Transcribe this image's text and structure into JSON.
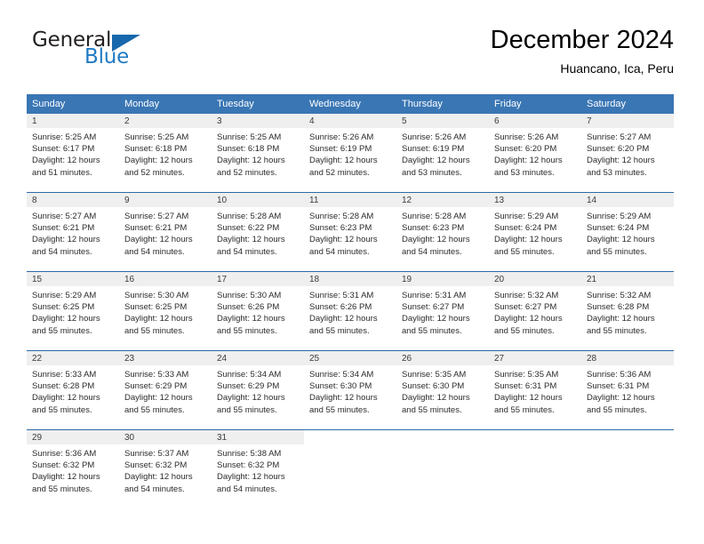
{
  "brand": {
    "name_part1": "General",
    "name_part2": "Blue",
    "logo_icon": "triangle-logo-icon"
  },
  "header": {
    "title": "December 2024",
    "location": "Huancano, Ica, Peru"
  },
  "colors": {
    "header_blue": "#3a76b4",
    "separator_blue": "#2e6aa8",
    "date_band_gray": "#efefef",
    "brand_blue": "#1f7ac4",
    "text": "#000000"
  },
  "weekdays": [
    "Sunday",
    "Monday",
    "Tuesday",
    "Wednesday",
    "Thursday",
    "Friday",
    "Saturday"
  ],
  "weeks": [
    [
      {
        "day": "1",
        "lines": [
          "Sunrise: 5:25 AM",
          "Sunset: 6:17 PM",
          "Daylight: 12 hours",
          "and 51 minutes."
        ]
      },
      {
        "day": "2",
        "lines": [
          "Sunrise: 5:25 AM",
          "Sunset: 6:18 PM",
          "Daylight: 12 hours",
          "and 52 minutes."
        ]
      },
      {
        "day": "3",
        "lines": [
          "Sunrise: 5:25 AM",
          "Sunset: 6:18 PM",
          "Daylight: 12 hours",
          "and 52 minutes."
        ]
      },
      {
        "day": "4",
        "lines": [
          "Sunrise: 5:26 AM",
          "Sunset: 6:19 PM",
          "Daylight: 12 hours",
          "and 52 minutes."
        ]
      },
      {
        "day": "5",
        "lines": [
          "Sunrise: 5:26 AM",
          "Sunset: 6:19 PM",
          "Daylight: 12 hours",
          "and 53 minutes."
        ]
      },
      {
        "day": "6",
        "lines": [
          "Sunrise: 5:26 AM",
          "Sunset: 6:20 PM",
          "Daylight: 12 hours",
          "and 53 minutes."
        ]
      },
      {
        "day": "7",
        "lines": [
          "Sunrise: 5:27 AM",
          "Sunset: 6:20 PM",
          "Daylight: 12 hours",
          "and 53 minutes."
        ]
      }
    ],
    [
      {
        "day": "8",
        "lines": [
          "Sunrise: 5:27 AM",
          "Sunset: 6:21 PM",
          "Daylight: 12 hours",
          "and 54 minutes."
        ]
      },
      {
        "day": "9",
        "lines": [
          "Sunrise: 5:27 AM",
          "Sunset: 6:21 PM",
          "Daylight: 12 hours",
          "and 54 minutes."
        ]
      },
      {
        "day": "10",
        "lines": [
          "Sunrise: 5:28 AM",
          "Sunset: 6:22 PM",
          "Daylight: 12 hours",
          "and 54 minutes."
        ]
      },
      {
        "day": "11",
        "lines": [
          "Sunrise: 5:28 AM",
          "Sunset: 6:23 PM",
          "Daylight: 12 hours",
          "and 54 minutes."
        ]
      },
      {
        "day": "12",
        "lines": [
          "Sunrise: 5:28 AM",
          "Sunset: 6:23 PM",
          "Daylight: 12 hours",
          "and 54 minutes."
        ]
      },
      {
        "day": "13",
        "lines": [
          "Sunrise: 5:29 AM",
          "Sunset: 6:24 PM",
          "Daylight: 12 hours",
          "and 55 minutes."
        ]
      },
      {
        "day": "14",
        "lines": [
          "Sunrise: 5:29 AM",
          "Sunset: 6:24 PM",
          "Daylight: 12 hours",
          "and 55 minutes."
        ]
      }
    ],
    [
      {
        "day": "15",
        "lines": [
          "Sunrise: 5:29 AM",
          "Sunset: 6:25 PM",
          "Daylight: 12 hours",
          "and 55 minutes."
        ]
      },
      {
        "day": "16",
        "lines": [
          "Sunrise: 5:30 AM",
          "Sunset: 6:25 PM",
          "Daylight: 12 hours",
          "and 55 minutes."
        ]
      },
      {
        "day": "17",
        "lines": [
          "Sunrise: 5:30 AM",
          "Sunset: 6:26 PM",
          "Daylight: 12 hours",
          "and 55 minutes."
        ]
      },
      {
        "day": "18",
        "lines": [
          "Sunrise: 5:31 AM",
          "Sunset: 6:26 PM",
          "Daylight: 12 hours",
          "and 55 minutes."
        ]
      },
      {
        "day": "19",
        "lines": [
          "Sunrise: 5:31 AM",
          "Sunset: 6:27 PM",
          "Daylight: 12 hours",
          "and 55 minutes."
        ]
      },
      {
        "day": "20",
        "lines": [
          "Sunrise: 5:32 AM",
          "Sunset: 6:27 PM",
          "Daylight: 12 hours",
          "and 55 minutes."
        ]
      },
      {
        "day": "21",
        "lines": [
          "Sunrise: 5:32 AM",
          "Sunset: 6:28 PM",
          "Daylight: 12 hours",
          "and 55 minutes."
        ]
      }
    ],
    [
      {
        "day": "22",
        "lines": [
          "Sunrise: 5:33 AM",
          "Sunset: 6:28 PM",
          "Daylight: 12 hours",
          "and 55 minutes."
        ]
      },
      {
        "day": "23",
        "lines": [
          "Sunrise: 5:33 AM",
          "Sunset: 6:29 PM",
          "Daylight: 12 hours",
          "and 55 minutes."
        ]
      },
      {
        "day": "24",
        "lines": [
          "Sunrise: 5:34 AM",
          "Sunset: 6:29 PM",
          "Daylight: 12 hours",
          "and 55 minutes."
        ]
      },
      {
        "day": "25",
        "lines": [
          "Sunrise: 5:34 AM",
          "Sunset: 6:30 PM",
          "Daylight: 12 hours",
          "and 55 minutes."
        ]
      },
      {
        "day": "26",
        "lines": [
          "Sunrise: 5:35 AM",
          "Sunset: 6:30 PM",
          "Daylight: 12 hours",
          "and 55 minutes."
        ]
      },
      {
        "day": "27",
        "lines": [
          "Sunrise: 5:35 AM",
          "Sunset: 6:31 PM",
          "Daylight: 12 hours",
          "and 55 minutes."
        ]
      },
      {
        "day": "28",
        "lines": [
          "Sunrise: 5:36 AM",
          "Sunset: 6:31 PM",
          "Daylight: 12 hours",
          "and 55 minutes."
        ]
      }
    ],
    [
      {
        "day": "29",
        "lines": [
          "Sunrise: 5:36 AM",
          "Sunset: 6:32 PM",
          "Daylight: 12 hours",
          "and 55 minutes."
        ]
      },
      {
        "day": "30",
        "lines": [
          "Sunrise: 5:37 AM",
          "Sunset: 6:32 PM",
          "Daylight: 12 hours",
          "and 54 minutes."
        ]
      },
      {
        "day": "31",
        "lines": [
          "Sunrise: 5:38 AM",
          "Sunset: 6:32 PM",
          "Daylight: 12 hours",
          "and 54 minutes."
        ]
      },
      {
        "day": "",
        "lines": []
      },
      {
        "day": "",
        "lines": []
      },
      {
        "day": "",
        "lines": []
      },
      {
        "day": "",
        "lines": []
      }
    ]
  ]
}
